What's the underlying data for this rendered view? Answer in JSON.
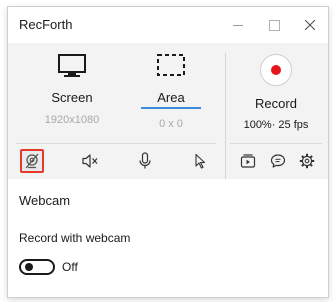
{
  "app": {
    "title": "RecForth"
  },
  "capture": {
    "screen": {
      "label": "Screen",
      "resolution": "1920x1080"
    },
    "area": {
      "label": "Area",
      "size": "0 x 0"
    },
    "record": {
      "label": "Record",
      "settings": "100%· 25 fps"
    }
  },
  "toolbar": {
    "icons": [
      "webcam-off-icon",
      "speaker-muted-icon",
      "microphone-icon",
      "cursor-icon",
      "screenshots-icon",
      "comment-icon",
      "gear-icon"
    ]
  },
  "webcam_panel": {
    "title": "Webcam",
    "option_label": "Record with webcam",
    "toggle_state": "Off"
  },
  "colors": {
    "record_dot": "#e8141c",
    "accent_underline": "#3c8ddb",
    "active_outline": "#e53a2b",
    "panel_bg": "#f3f3f3"
  }
}
